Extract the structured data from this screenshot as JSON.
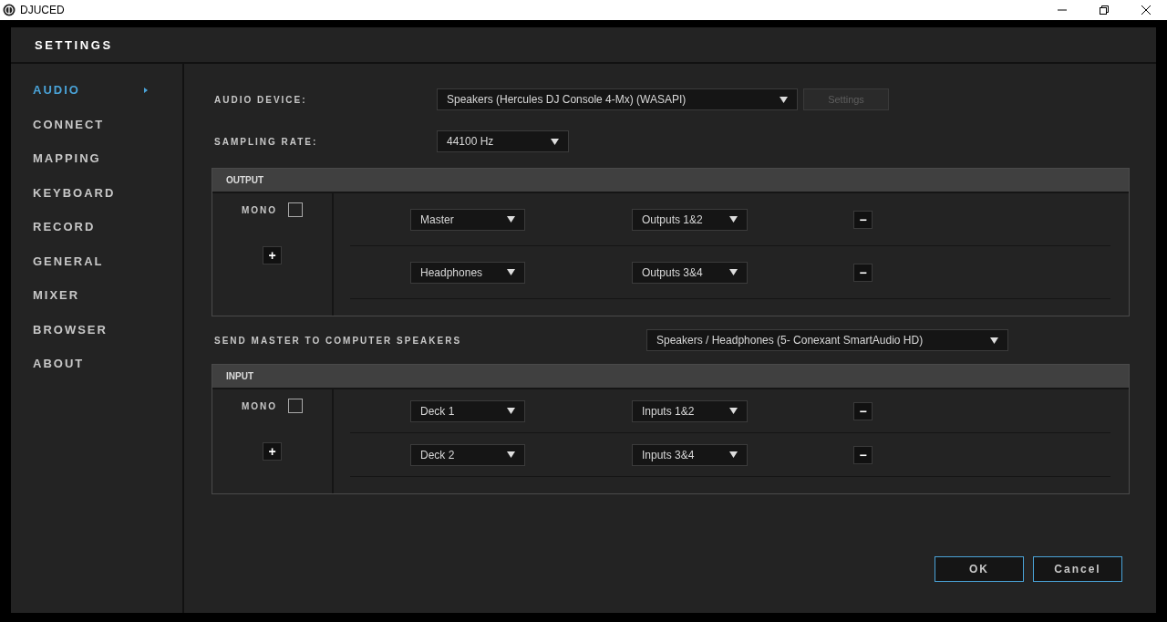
{
  "window": {
    "title": "DJUCED"
  },
  "dialog_title": "SETTINGS",
  "sidebar": {
    "items": [
      {
        "label": "AUDIO",
        "selected": true
      },
      {
        "label": "CONNECT",
        "selected": false
      },
      {
        "label": "MAPPING",
        "selected": false
      },
      {
        "label": "KEYBOARD",
        "selected": false
      },
      {
        "label": "RECORD",
        "selected": false
      },
      {
        "label": "GENERAL",
        "selected": false
      },
      {
        "label": "MIXER",
        "selected": false
      },
      {
        "label": "BROWSER",
        "selected": false
      },
      {
        "label": "ABOUT",
        "selected": false
      }
    ]
  },
  "audio_device": {
    "label": "AUDIO DEVICE:",
    "value": "Speakers (Hercules DJ Console 4-Mx) (WASAPI)",
    "settings_button": {
      "label": "Settings",
      "disabled": true
    }
  },
  "sampling_rate": {
    "label": "SAMPLING RATE:",
    "value": "44100 Hz"
  },
  "output": {
    "title": "OUTPUT",
    "mono_label": "MONO",
    "mono_checked": false,
    "add_button": "+",
    "rows": [
      {
        "source": "Master",
        "channels": "Outputs 1&2",
        "remove": "−"
      },
      {
        "source": "Headphones",
        "channels": "Outputs 3&4",
        "remove": "−"
      }
    ]
  },
  "send_master": {
    "label": "SEND MASTER TO COMPUTER SPEAKERS",
    "value": "Speakers / Headphones (5- Conexant SmartAudio HD)"
  },
  "input": {
    "title": "INPUT",
    "mono_label": "MONO",
    "mono_checked": false,
    "add_button": "+",
    "rows": [
      {
        "source": "Deck 1",
        "channels": "Inputs 1&2",
        "remove": "−"
      },
      {
        "source": "Deck 2",
        "channels": "Inputs 3&4",
        "remove": "−"
      }
    ]
  },
  "buttons": [
    "OK",
    "Cancel"
  ]
}
